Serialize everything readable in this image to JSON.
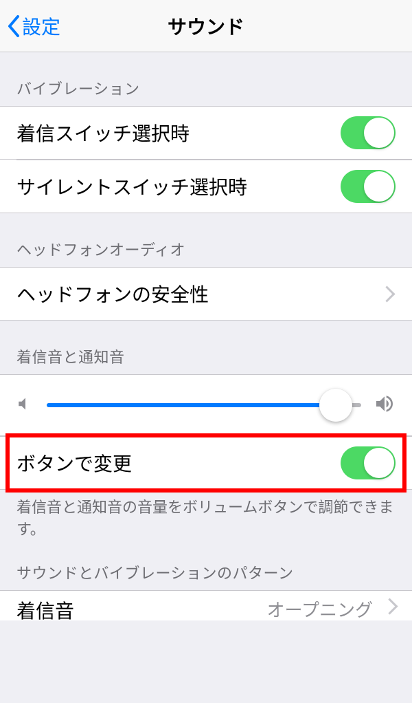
{
  "nav": {
    "back_label": "設定",
    "title": "サウンド"
  },
  "sections": {
    "vibration": {
      "header": "バイブレーション",
      "ring_switch": {
        "label": "着信スイッチ選択時",
        "on": true
      },
      "silent_switch": {
        "label": "サイレントスイッチ選択時",
        "on": true
      }
    },
    "headphone": {
      "header": "ヘッドフォンオーディオ",
      "safety": {
        "label": "ヘッドフォンの安全性"
      }
    },
    "ringtone": {
      "header": "着信音と通知音",
      "volume_percent": 92,
      "change_with_buttons": {
        "label": "ボタンで変更",
        "on": true
      },
      "footer": "着信音と通知音の音量をボリュームボタンで調節できます。"
    },
    "patterns": {
      "header": "サウンドとバイブレーションのパターン",
      "ringtone": {
        "label": "着信音",
        "value": "オープニング"
      }
    }
  }
}
